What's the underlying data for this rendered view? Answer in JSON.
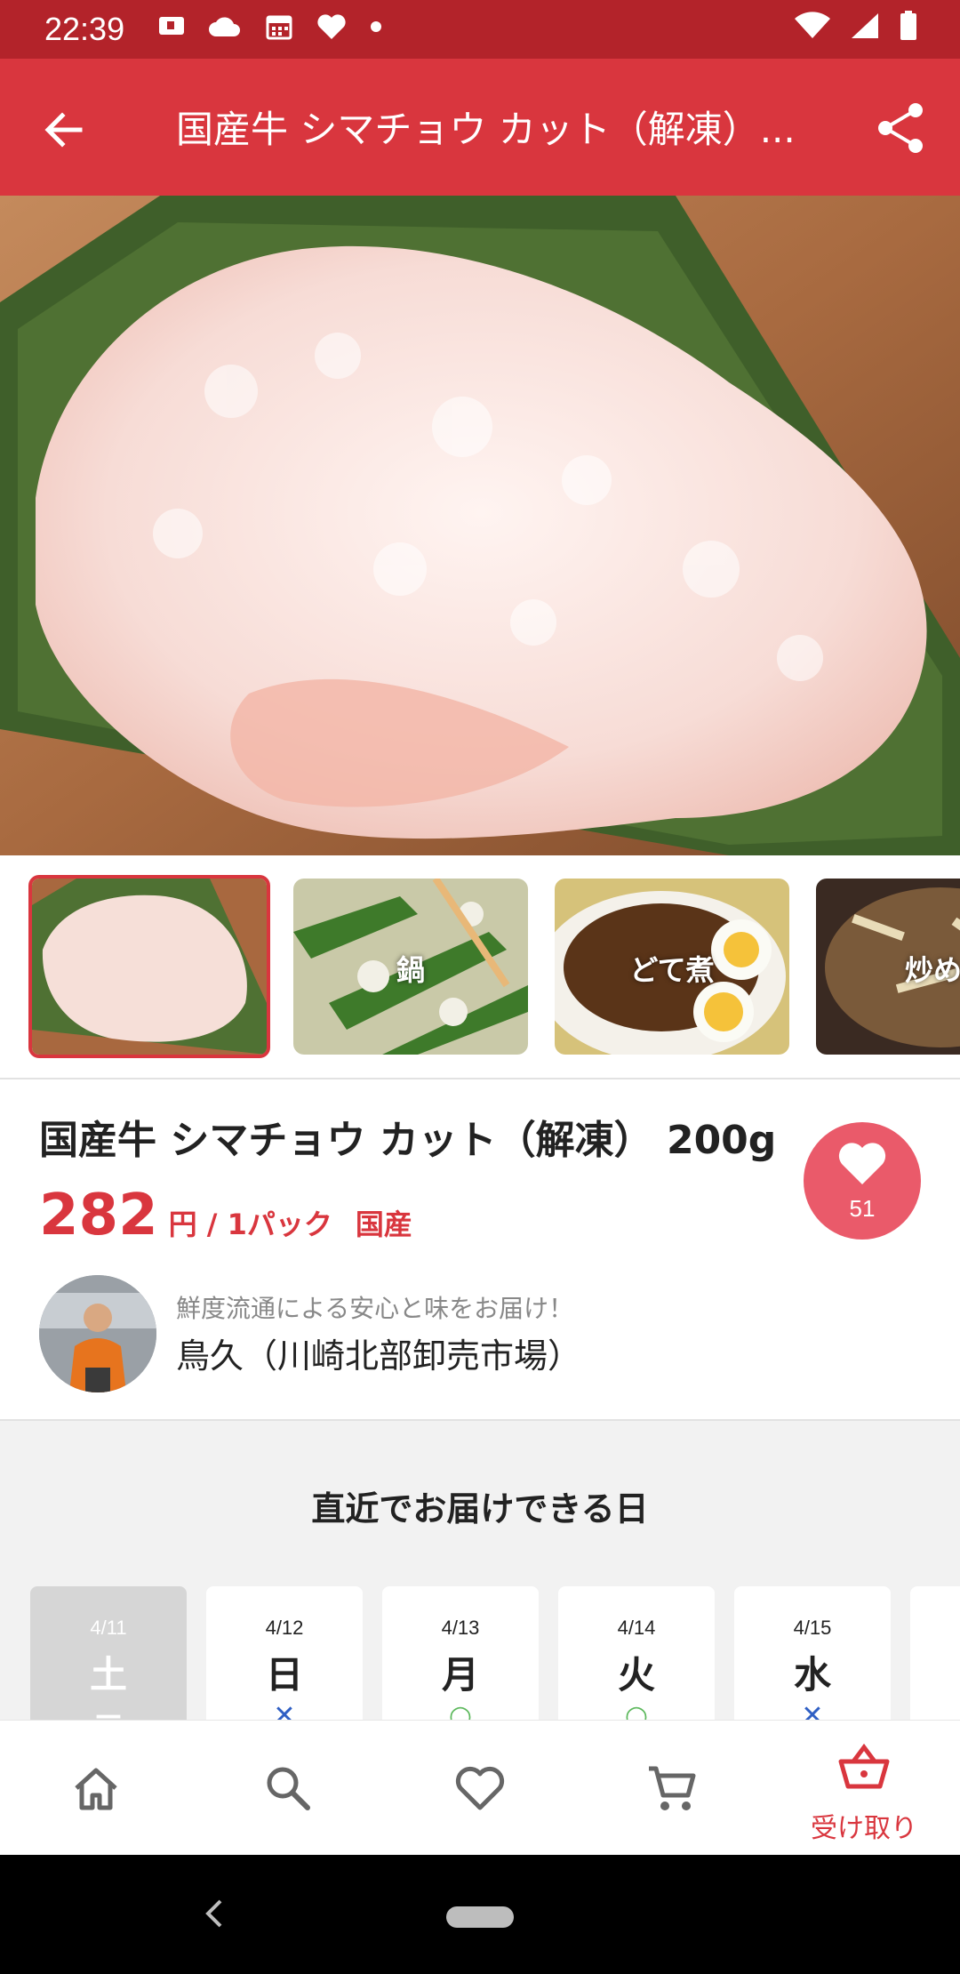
{
  "status_bar": {
    "time": "22:39"
  },
  "app_bar": {
    "title": "国産牛 シマチョウ カット（解凍）..."
  },
  "gallery": {
    "thumbnails": [
      {
        "label": ""
      },
      {
        "label": "鍋"
      },
      {
        "label": "どて煮"
      },
      {
        "label": "炒め"
      }
    ]
  },
  "product": {
    "name": "国産牛 シマチョウ カット（解凍） 200g",
    "price": "282",
    "price_unit": "円 / 1パック",
    "origin": "国産",
    "likes": "51"
  },
  "seller": {
    "tagline": "鮮度流通による安心と味をお届け！",
    "name": "鳥久（川崎北部卸売市場）"
  },
  "delivery": {
    "title": "直近でお届けできる日",
    "days": [
      {
        "date": "4/11",
        "weekday": "土",
        "mark": "—",
        "available": false
      },
      {
        "date": "4/12",
        "weekday": "日",
        "mark": "✕",
        "available": false
      },
      {
        "date": "4/13",
        "weekday": "月",
        "mark": "○",
        "available": true
      },
      {
        "date": "4/14",
        "weekday": "火",
        "mark": "○",
        "available": true
      },
      {
        "date": "4/15",
        "weekday": "水",
        "mark": "✕",
        "available": false
      }
    ]
  },
  "bottom_nav": {
    "items": [
      {
        "icon": "home-icon",
        "label": ""
      },
      {
        "icon": "search-icon",
        "label": ""
      },
      {
        "icon": "heart-icon",
        "label": ""
      },
      {
        "icon": "cart-icon",
        "label": ""
      },
      {
        "icon": "basket-icon",
        "label": "受け取り"
      }
    ]
  },
  "colors": {
    "status_bar": "#b3232a",
    "app_bar": "#d9363e",
    "accent": "#d9363e",
    "like_button": "#ea5a6a"
  }
}
